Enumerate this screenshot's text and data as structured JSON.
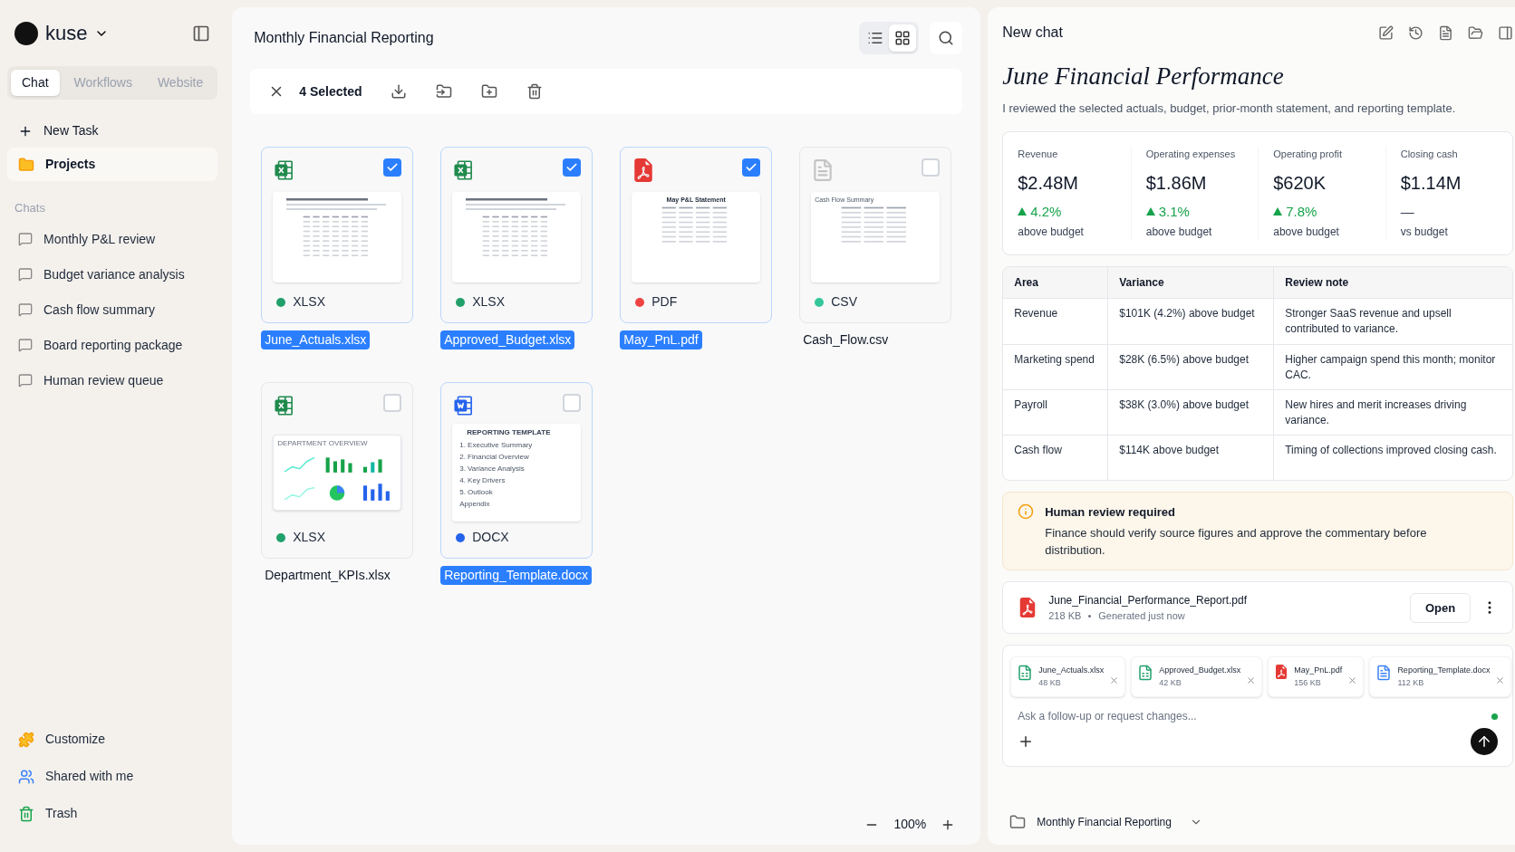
{
  "sidebar": {
    "brand": "kuse",
    "tabs": [
      {
        "label": "Chat",
        "selected": true
      },
      {
        "label": "Workflows",
        "selected": false
      },
      {
        "label": "Website",
        "selected": false
      }
    ],
    "new_task": "New Task",
    "nav": [
      {
        "label": "Projects",
        "selected": true
      }
    ],
    "chats_heading": "Chats",
    "chats": [
      "Monthly P&L review",
      "Budget variance analysis",
      "Cash flow summary",
      "Board reporting package",
      "Human review queue"
    ],
    "bottom": [
      {
        "label": "Customize",
        "kind": "puzzle"
      },
      {
        "label": "Shared with me",
        "kind": "shared"
      },
      {
        "label": "Trash",
        "kind": "trash"
      }
    ]
  },
  "files_panel": {
    "title": "Monthly Financial Reporting",
    "view_modes": [
      {
        "kind": "list",
        "selected": false
      },
      {
        "kind": "grid",
        "selected": true
      }
    ],
    "selection_bar": {
      "label": "4 Selected"
    },
    "files": [
      {
        "name": "June_Actuals.xlsx",
        "type": "XLSX",
        "kind": "excel",
        "color": "#22a06b",
        "checked": true,
        "selected": true,
        "preview": {
          "kind": "sheet"
        }
      },
      {
        "name": "Approved_Budget.xlsx",
        "type": "XLSX",
        "kind": "excel",
        "color": "#22a06b",
        "checked": true,
        "selected": true,
        "preview": {
          "kind": "sheet"
        }
      },
      {
        "name": "May_PnL.pdf",
        "type": "PDF",
        "kind": "pdf",
        "color": "#ef4444",
        "checked": true,
        "selected": true,
        "preview": {
          "kind": "statement",
          "title": "May P&L Statement"
        }
      },
      {
        "name": "Cash_Flow.csv",
        "type": "CSV",
        "kind": "csv",
        "color": "#34c79a",
        "checked": false,
        "selected": false,
        "preview": {
          "kind": "summary",
          "title": "Cash Flow Summary"
        }
      },
      {
        "name": "Department_KPIs.xlsx",
        "type": "XLSX",
        "kind": "excel",
        "color": "#22a06b",
        "checked": false,
        "selected": false,
        "preview": {
          "kind": "dashboard",
          "title": "DEPARTMENT OVERVIEW"
        }
      },
      {
        "name": "Reporting_Template.docx",
        "type": "DOCX",
        "kind": "word",
        "color": "#2563eb",
        "checked": false,
        "selected": true,
        "preview": {
          "kind": "template",
          "title": "REPORTING TEMPLATE",
          "items": [
            "1. Executive Summary",
            "2. Financial Overview",
            "3. Variance Analysis",
            "4. Key Drivers",
            "5. Outlook",
            "Appendix"
          ]
        }
      }
    ],
    "zoom": "100%"
  },
  "chat": {
    "title": "New chat",
    "heading": "June Financial Performance",
    "intro": "I reviewed the selected actuals, budget, prior-month statement, and reporting template.",
    "kpis": [
      {
        "label": "Revenue",
        "value": "$2.48M",
        "up": true,
        "change": "4.2%",
        "note": "above budget"
      },
      {
        "label": "Operating expenses",
        "value": "$1.86M",
        "up": true,
        "change": "3.1%",
        "note": "above budget"
      },
      {
        "label": "Operating profit",
        "value": "$620K",
        "up": true,
        "change": "7.8%",
        "note": "above budget"
      },
      {
        "label": "Closing cash",
        "value": "$1.14M",
        "up": false,
        "change": "—",
        "note": "vs budget"
      }
    ],
    "table": {
      "columns": [
        "Area",
        "Variance",
        "Review note"
      ],
      "rows": [
        [
          "Revenue",
          "$101K (4.2%) above budget",
          "Stronger SaaS revenue and upsell contributed to variance."
        ],
        [
          "Marketing spend",
          "$28K (6.5%) above budget",
          "Higher campaign spend this month; monitor CAC."
        ],
        [
          "Payroll",
          "$38K (3.0%) above budget",
          "New hires and merit increases driving variance."
        ],
        [
          "Cash flow",
          "$114K above budget",
          "Timing of collections improved closing cash."
        ]
      ]
    },
    "alert": {
      "title": "Human review required",
      "body": "Finance should verify source figures and approve the commentary before distribution."
    },
    "report": {
      "name": "June_Financial_Performance_Report.pdf",
      "size": "218 KB",
      "status": "Generated just now",
      "button": "Open"
    },
    "attachments": [
      {
        "name": "June_Actuals.xlsx",
        "size": "48 KB",
        "kind": "excel"
      },
      {
        "name": "Approved_Budget.xlsx",
        "size": "42 KB",
        "kind": "excel"
      },
      {
        "name": "May_PnL.pdf",
        "size": "156 KB",
        "kind": "pdf"
      },
      {
        "name": "Reporting_Template.docx",
        "size": "112 KB",
        "kind": "word"
      }
    ],
    "composer": {
      "placeholder": "Ask a follow-up or request changes..."
    },
    "footer": {
      "project": "Monthly Financial Reporting"
    }
  }
}
